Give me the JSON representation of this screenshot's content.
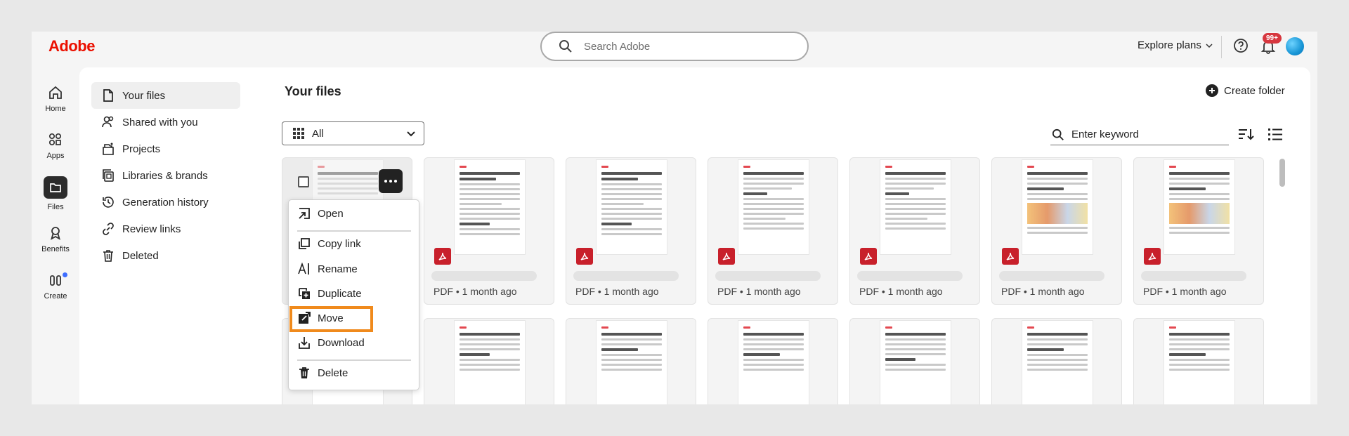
{
  "header": {
    "logo": "Adobe",
    "search_placeholder": "Search Adobe",
    "explore_label": "Explore plans",
    "notification_badge": "99+"
  },
  "rail": {
    "items": [
      {
        "label": "Home",
        "icon": "home-icon"
      },
      {
        "label": "Apps",
        "icon": "apps-icon"
      },
      {
        "label": "Files",
        "icon": "folder-icon",
        "active": true
      },
      {
        "label": "Benefits",
        "icon": "benefits-icon"
      },
      {
        "label": "Create",
        "icon": "create-icon"
      }
    ]
  },
  "nav": {
    "items": [
      {
        "label": "Your files",
        "icon": "file-icon",
        "active": true
      },
      {
        "label": "Shared with you",
        "icon": "shared-icon"
      },
      {
        "label": "Projects",
        "icon": "projects-icon"
      },
      {
        "label": "Libraries & brands",
        "icon": "libraries-icon"
      },
      {
        "label": "Generation history",
        "icon": "history-icon"
      },
      {
        "label": "Review links",
        "icon": "link-icon"
      },
      {
        "label": "Deleted",
        "icon": "trash-icon"
      }
    ]
  },
  "main": {
    "title": "Your files",
    "create_folder_label": "Create folder",
    "filter_label": "All",
    "keyword_placeholder": "Enter keyword"
  },
  "files": [
    {
      "meta": "PDF • 1 month ago"
    },
    {
      "meta": "PDF • 1 month ago"
    },
    {
      "meta": "PDF • 1 month ago"
    },
    {
      "meta": "PDF • 1 month ago"
    },
    {
      "meta": "PDF • 1 month ago"
    },
    {
      "meta": "PDF • 1 month ago"
    }
  ],
  "context_menu": {
    "items": [
      {
        "label": "Open",
        "icon": "open-icon"
      },
      {
        "label": "Copy link",
        "icon": "copy-link-icon"
      },
      {
        "label": "Rename",
        "icon": "rename-icon"
      },
      {
        "label": "Duplicate",
        "icon": "duplicate-icon"
      },
      {
        "label": "Move",
        "icon": "move-icon",
        "highlighted": true
      },
      {
        "label": "Download",
        "icon": "download-icon"
      },
      {
        "label": "Delete",
        "icon": "delete-icon"
      }
    ]
  },
  "colors": {
    "brand": "#eb1000",
    "pdf_badge": "#c8202b",
    "highlight": "#f08a1c",
    "notification": "#d7373f"
  }
}
